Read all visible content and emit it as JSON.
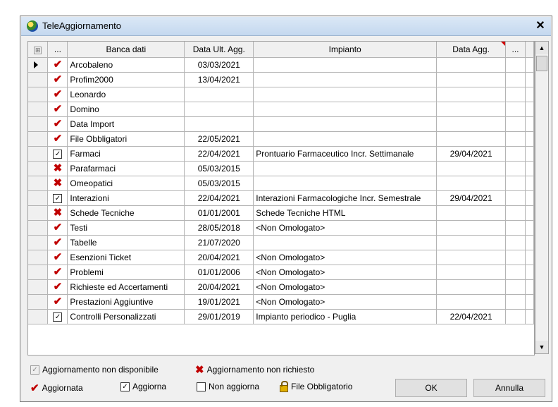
{
  "window": {
    "title": "TeleAggiornamento",
    "close_label": "✕"
  },
  "grid": {
    "headers": {
      "expand": "⊞",
      "status": "...",
      "banca": "Banca dati",
      "data_ult": "Data Ult. Agg.",
      "impianto": "Impianto",
      "data_agg": "Data Agg.",
      "extra": "..."
    },
    "rows": [
      {
        "status": "check",
        "banca": "Arcobaleno",
        "data_ult": "03/03/2021",
        "impianto": "",
        "data_agg": "",
        "current": true
      },
      {
        "status": "check",
        "banca": "Profim2000",
        "data_ult": "13/04/2021",
        "impianto": "",
        "data_agg": ""
      },
      {
        "status": "check",
        "banca": "Leonardo",
        "data_ult": "",
        "impianto": "",
        "data_agg": ""
      },
      {
        "status": "check",
        "banca": "Domino",
        "data_ult": "",
        "impianto": "",
        "data_agg": ""
      },
      {
        "status": "check",
        "banca": "Data Import",
        "data_ult": "",
        "impianto": "",
        "data_agg": ""
      },
      {
        "status": "check",
        "banca": "File Obbligatori",
        "data_ult": "22/05/2021",
        "impianto": "",
        "data_agg": ""
      },
      {
        "status": "box",
        "banca": "Farmaci",
        "data_ult": "22/04/2021",
        "impianto": "Prontuario Farmaceutico Incr. Settimanale",
        "data_agg": "29/04/2021"
      },
      {
        "status": "cross",
        "banca": "Parafarmaci",
        "data_ult": "05/03/2015",
        "impianto": "",
        "data_agg": ""
      },
      {
        "status": "cross",
        "banca": "Omeopatici",
        "data_ult": "05/03/2015",
        "impianto": "",
        "data_agg": ""
      },
      {
        "status": "box",
        "banca": "Interazioni",
        "data_ult": "22/04/2021",
        "impianto": "Interazioni Farmacologiche Incr. Semestrale",
        "data_agg": "29/04/2021"
      },
      {
        "status": "cross",
        "banca": "Schede Tecniche",
        "data_ult": "01/01/2001",
        "impianto": "Schede Tecniche HTML",
        "data_agg": ""
      },
      {
        "status": "check",
        "banca": "Testi",
        "data_ult": "28/05/2018",
        "impianto": "<Non Omologato>",
        "data_agg": ""
      },
      {
        "status": "check",
        "banca": "Tabelle",
        "data_ult": "21/07/2020",
        "impianto": "",
        "data_agg": ""
      },
      {
        "status": "check",
        "banca": "Esenzioni Ticket",
        "data_ult": "20/04/2021",
        "impianto": "<Non Omologato>",
        "data_agg": ""
      },
      {
        "status": "check",
        "banca": "Problemi",
        "data_ult": "01/01/2006",
        "impianto": "<Non Omologato>",
        "data_agg": ""
      },
      {
        "status": "check",
        "banca": "Richieste ed Accertamenti",
        "data_ult": "20/04/2021",
        "impianto": "<Non Omologato>",
        "data_agg": ""
      },
      {
        "status": "check",
        "banca": "Prestazioni Aggiuntive",
        "data_ult": "19/01/2021",
        "impianto": "<Non Omologato>",
        "data_agg": ""
      },
      {
        "status": "box",
        "banca": "Controlli Personalizzati",
        "data_ult": "29/01/2019",
        "impianto": "Impianto periodico - Puglia",
        "data_agg": "22/04/2021"
      }
    ]
  },
  "legend": {
    "not_available": "Aggiornamento non disponibile",
    "not_requested": "Aggiornamento non richiesto",
    "updated": "Aggiornata",
    "update": "Aggiorna",
    "no_update": "Non aggiorna",
    "mandatory_file": "File Obbligatorio"
  },
  "buttons": {
    "ok": "OK",
    "cancel": "Annulla"
  },
  "colors": {
    "status_red": "#c00000",
    "title_bar": "#c4d8ef"
  }
}
